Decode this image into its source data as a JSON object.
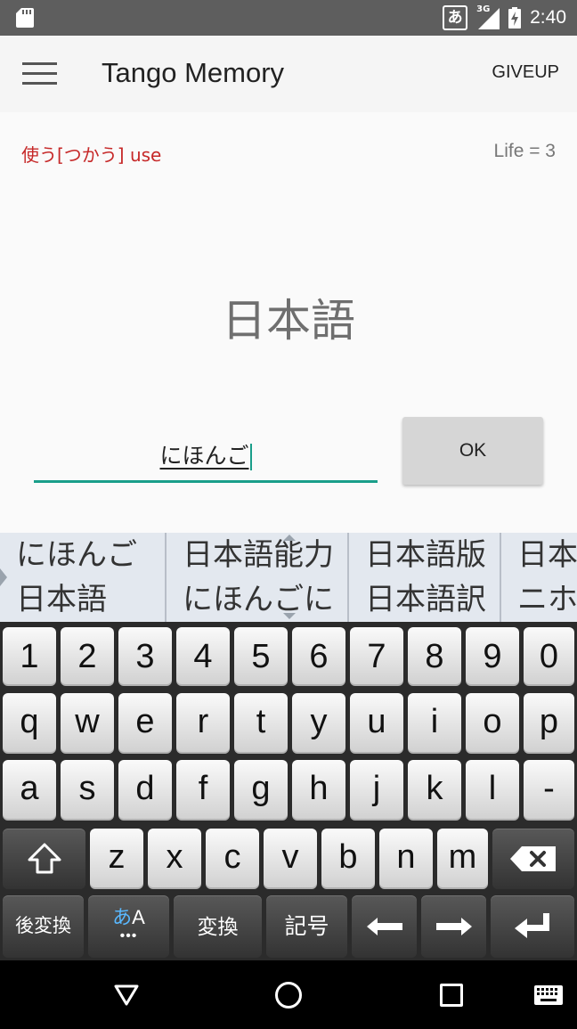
{
  "status_bar": {
    "ime_indicator": "あ",
    "network": "3G",
    "time": "2:40",
    "icons": [
      "sd-card-icon",
      "signal-icon",
      "battery-charging-icon"
    ]
  },
  "app_bar": {
    "title": "Tango Memory",
    "action": "GIVEUP",
    "menu_icon": "hamburger-menu-icon"
  },
  "quiz": {
    "hint": "使う[つかう] use",
    "life": "Life = 3",
    "word": "日本語",
    "answer_value": "にほんご",
    "ok_label": "OK"
  },
  "candidates": [
    [
      "にほんご",
      "日本語"
    ],
    [
      "日本語能力",
      "にほんごに"
    ],
    [
      "日本語版",
      "日本語訳"
    ],
    [
      "日本",
      "ニホ"
    ]
  ],
  "keyboard": {
    "row_numbers": [
      "1",
      "2",
      "3",
      "4",
      "5",
      "6",
      "7",
      "8",
      "9",
      "0"
    ],
    "row_top": [
      "q",
      "w",
      "e",
      "r",
      "t",
      "y",
      "u",
      "i",
      "o",
      "p"
    ],
    "row_middle": [
      "a",
      "s",
      "d",
      "f",
      "g",
      "h",
      "j",
      "k",
      "l",
      "-"
    ],
    "row_bottom": [
      "z",
      "x",
      "c",
      "v",
      "b",
      "n",
      "m"
    ],
    "shift_icon": "shift-icon",
    "backspace_icon": "backspace-icon",
    "function_row": {
      "reconvert": "後変換",
      "mode_kana": "あ",
      "mode_alpha": "A",
      "convert": "変換",
      "symbols": "記号",
      "left_icon": "arrow-left-icon",
      "right_icon": "arrow-right-icon",
      "enter_icon": "enter-icon"
    }
  },
  "nav_bar": {
    "icons": [
      "back-icon",
      "home-icon",
      "recents-icon",
      "keyboard-switch-icon"
    ]
  }
}
